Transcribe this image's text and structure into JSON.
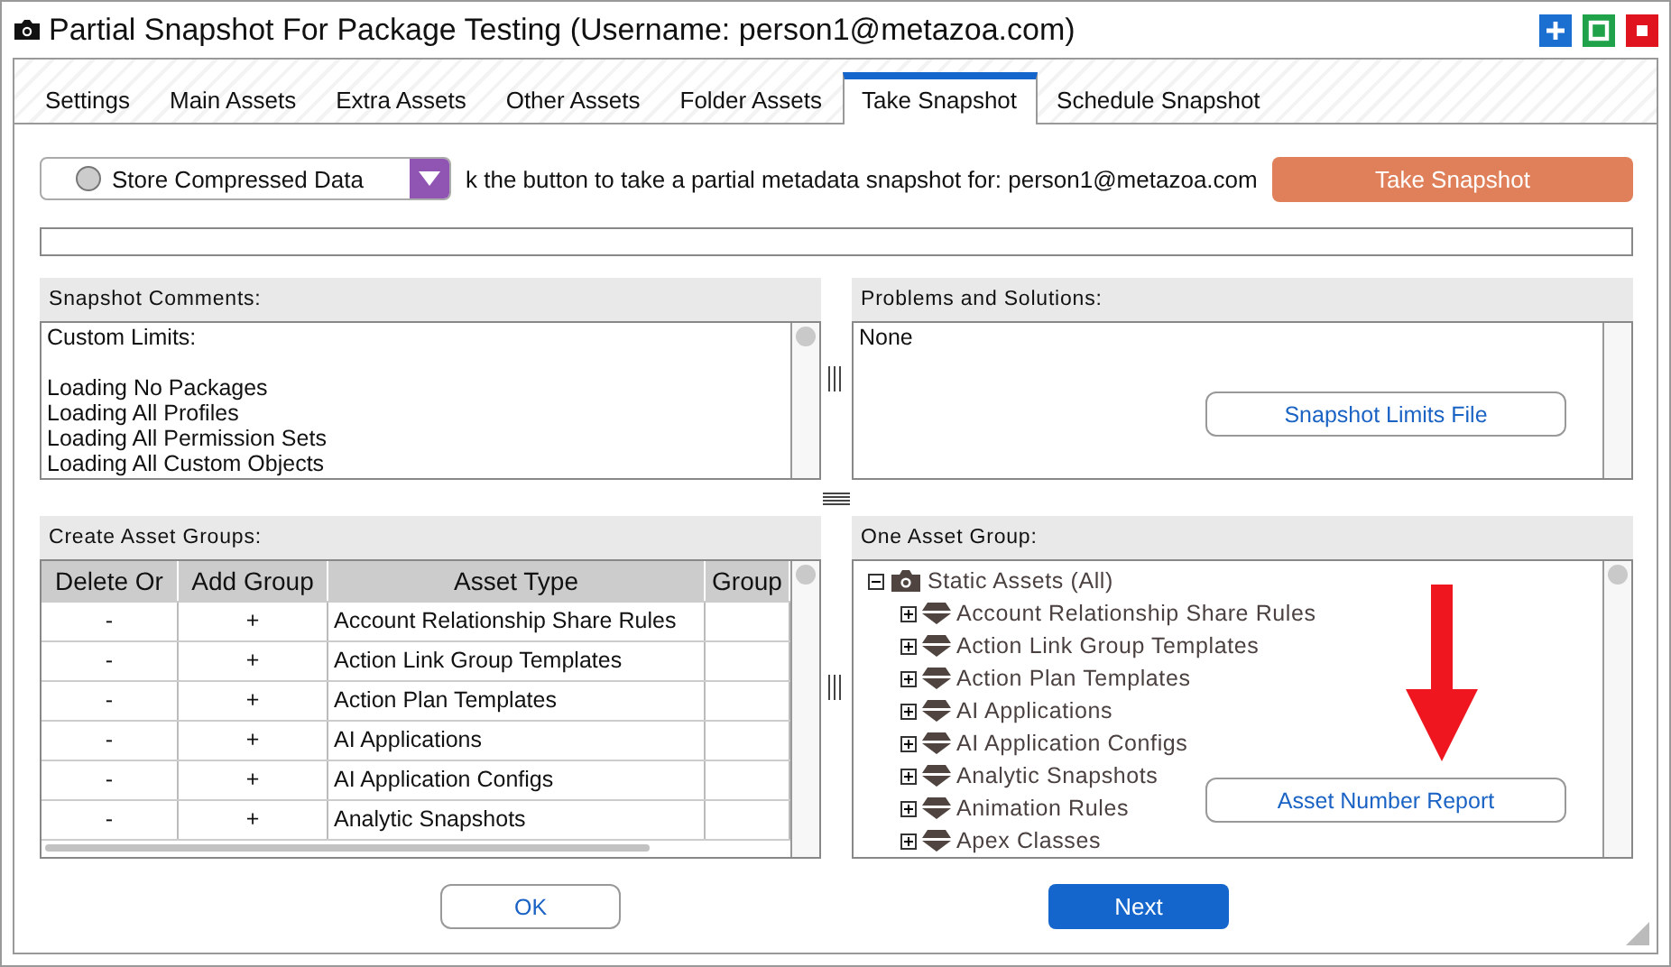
{
  "window": {
    "title": "Partial Snapshot For Package Testing (Username: person1@metazoa.com)"
  },
  "tabs": [
    {
      "label": "Settings",
      "selected": false
    },
    {
      "label": "Main Assets",
      "selected": false
    },
    {
      "label": "Extra Assets",
      "selected": false
    },
    {
      "label": "Other Assets",
      "selected": false
    },
    {
      "label": "Folder Assets",
      "selected": false
    },
    {
      "label": "Take Snapshot",
      "selected": true
    },
    {
      "label": "Schedule Snapshot",
      "selected": false
    }
  ],
  "dropdown": {
    "value": "Store Compressed Data"
  },
  "instruction": "k the button to take a partial metadata snapshot for: person1@metazoa.com",
  "take_snapshot_button": "Take Snapshot",
  "progress": {
    "level": 0
  },
  "snapshot_comments": {
    "title": "Snapshot Comments:",
    "heading": "Custom Limits:",
    "lines": [
      "Loading No Packages",
      "Loading All Profiles",
      "Loading All Permission Sets",
      "Loading All Custom Objects"
    ]
  },
  "problems": {
    "title": "Problems and Solutions:",
    "text": "None",
    "button": "Snapshot Limits File"
  },
  "asset_groups": {
    "title": "Create Asset Groups:",
    "columns": [
      "Delete Or",
      "Add Group",
      "Asset Type",
      "Group"
    ],
    "rows": [
      {
        "delete": "-",
        "add": "+",
        "asset_type": "Account Relationship Share Rules"
      },
      {
        "delete": "-",
        "add": "+",
        "asset_type": "Action Link Group Templates"
      },
      {
        "delete": "-",
        "add": "+",
        "asset_type": "Action Plan Templates"
      },
      {
        "delete": "-",
        "add": "+",
        "asset_type": "AI Applications"
      },
      {
        "delete": "-",
        "add": "+",
        "asset_type": "AI Application Configs"
      },
      {
        "delete": "-",
        "add": "+",
        "asset_type": "Analytic Snapshots"
      }
    ]
  },
  "one_asset_group": {
    "title": "One Asset Group:",
    "button": "Asset Number Report",
    "tree": {
      "label": "Static Assets (All)",
      "expanded": true,
      "children": [
        {
          "label": "Account Relationship Share Rules",
          "expanded": false
        },
        {
          "label": "Action Link Group Templates",
          "expanded": false
        },
        {
          "label": "Action Plan Templates",
          "expanded": false
        },
        {
          "label": "AI Applications",
          "expanded": false
        },
        {
          "label": "AI Application Configs",
          "expanded": false
        },
        {
          "label": "Analytic Snapshots",
          "expanded": false
        },
        {
          "label": "Animation Rules",
          "expanded": false
        },
        {
          "label": "Apex Classes",
          "expanded": false
        }
      ]
    }
  },
  "buttons": {
    "ok": "OK",
    "next": "Next"
  }
}
